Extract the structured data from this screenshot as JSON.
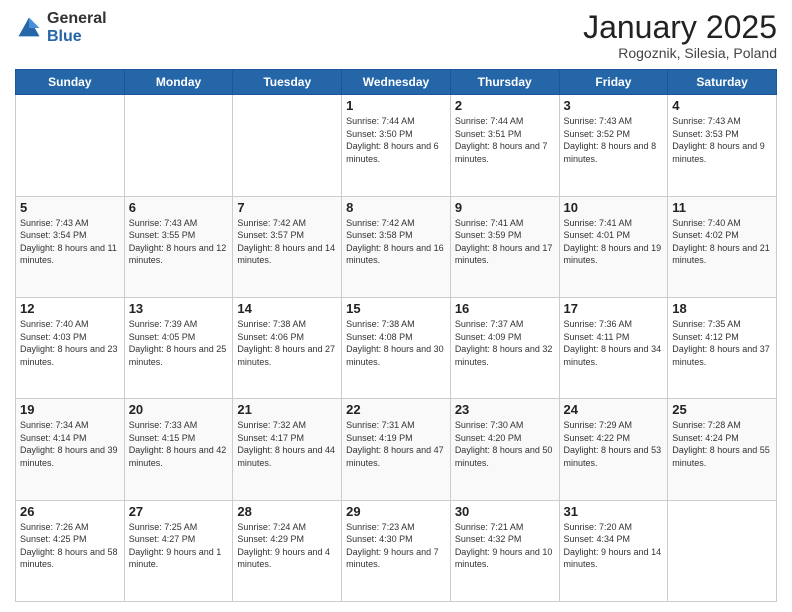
{
  "logo": {
    "general": "General",
    "blue": "Blue"
  },
  "header": {
    "month": "January 2025",
    "location": "Rogoznik, Silesia, Poland"
  },
  "weekdays": [
    "Sunday",
    "Monday",
    "Tuesday",
    "Wednesday",
    "Thursday",
    "Friday",
    "Saturday"
  ],
  "weeks": [
    [
      {
        "day": "",
        "info": ""
      },
      {
        "day": "",
        "info": ""
      },
      {
        "day": "",
        "info": ""
      },
      {
        "day": "1",
        "info": "Sunrise: 7:44 AM\nSunset: 3:50 PM\nDaylight: 8 hours and 6 minutes."
      },
      {
        "day": "2",
        "info": "Sunrise: 7:44 AM\nSunset: 3:51 PM\nDaylight: 8 hours and 7 minutes."
      },
      {
        "day": "3",
        "info": "Sunrise: 7:43 AM\nSunset: 3:52 PM\nDaylight: 8 hours and 8 minutes."
      },
      {
        "day": "4",
        "info": "Sunrise: 7:43 AM\nSunset: 3:53 PM\nDaylight: 8 hours and 9 minutes."
      }
    ],
    [
      {
        "day": "5",
        "info": "Sunrise: 7:43 AM\nSunset: 3:54 PM\nDaylight: 8 hours and 11 minutes."
      },
      {
        "day": "6",
        "info": "Sunrise: 7:43 AM\nSunset: 3:55 PM\nDaylight: 8 hours and 12 minutes."
      },
      {
        "day": "7",
        "info": "Sunrise: 7:42 AM\nSunset: 3:57 PM\nDaylight: 8 hours and 14 minutes."
      },
      {
        "day": "8",
        "info": "Sunrise: 7:42 AM\nSunset: 3:58 PM\nDaylight: 8 hours and 16 minutes."
      },
      {
        "day": "9",
        "info": "Sunrise: 7:41 AM\nSunset: 3:59 PM\nDaylight: 8 hours and 17 minutes."
      },
      {
        "day": "10",
        "info": "Sunrise: 7:41 AM\nSunset: 4:01 PM\nDaylight: 8 hours and 19 minutes."
      },
      {
        "day": "11",
        "info": "Sunrise: 7:40 AM\nSunset: 4:02 PM\nDaylight: 8 hours and 21 minutes."
      }
    ],
    [
      {
        "day": "12",
        "info": "Sunrise: 7:40 AM\nSunset: 4:03 PM\nDaylight: 8 hours and 23 minutes."
      },
      {
        "day": "13",
        "info": "Sunrise: 7:39 AM\nSunset: 4:05 PM\nDaylight: 8 hours and 25 minutes."
      },
      {
        "day": "14",
        "info": "Sunrise: 7:38 AM\nSunset: 4:06 PM\nDaylight: 8 hours and 27 minutes."
      },
      {
        "day": "15",
        "info": "Sunrise: 7:38 AM\nSunset: 4:08 PM\nDaylight: 8 hours and 30 minutes."
      },
      {
        "day": "16",
        "info": "Sunrise: 7:37 AM\nSunset: 4:09 PM\nDaylight: 8 hours and 32 minutes."
      },
      {
        "day": "17",
        "info": "Sunrise: 7:36 AM\nSunset: 4:11 PM\nDaylight: 8 hours and 34 minutes."
      },
      {
        "day": "18",
        "info": "Sunrise: 7:35 AM\nSunset: 4:12 PM\nDaylight: 8 hours and 37 minutes."
      }
    ],
    [
      {
        "day": "19",
        "info": "Sunrise: 7:34 AM\nSunset: 4:14 PM\nDaylight: 8 hours and 39 minutes."
      },
      {
        "day": "20",
        "info": "Sunrise: 7:33 AM\nSunset: 4:15 PM\nDaylight: 8 hours and 42 minutes."
      },
      {
        "day": "21",
        "info": "Sunrise: 7:32 AM\nSunset: 4:17 PM\nDaylight: 8 hours and 44 minutes."
      },
      {
        "day": "22",
        "info": "Sunrise: 7:31 AM\nSunset: 4:19 PM\nDaylight: 8 hours and 47 minutes."
      },
      {
        "day": "23",
        "info": "Sunrise: 7:30 AM\nSunset: 4:20 PM\nDaylight: 8 hours and 50 minutes."
      },
      {
        "day": "24",
        "info": "Sunrise: 7:29 AM\nSunset: 4:22 PM\nDaylight: 8 hours and 53 minutes."
      },
      {
        "day": "25",
        "info": "Sunrise: 7:28 AM\nSunset: 4:24 PM\nDaylight: 8 hours and 55 minutes."
      }
    ],
    [
      {
        "day": "26",
        "info": "Sunrise: 7:26 AM\nSunset: 4:25 PM\nDaylight: 8 hours and 58 minutes."
      },
      {
        "day": "27",
        "info": "Sunrise: 7:25 AM\nSunset: 4:27 PM\nDaylight: 9 hours and 1 minute."
      },
      {
        "day": "28",
        "info": "Sunrise: 7:24 AM\nSunset: 4:29 PM\nDaylight: 9 hours and 4 minutes."
      },
      {
        "day": "29",
        "info": "Sunrise: 7:23 AM\nSunset: 4:30 PM\nDaylight: 9 hours and 7 minutes."
      },
      {
        "day": "30",
        "info": "Sunrise: 7:21 AM\nSunset: 4:32 PM\nDaylight: 9 hours and 10 minutes."
      },
      {
        "day": "31",
        "info": "Sunrise: 7:20 AM\nSunset: 4:34 PM\nDaylight: 9 hours and 14 minutes."
      },
      {
        "day": "",
        "info": ""
      }
    ]
  ]
}
